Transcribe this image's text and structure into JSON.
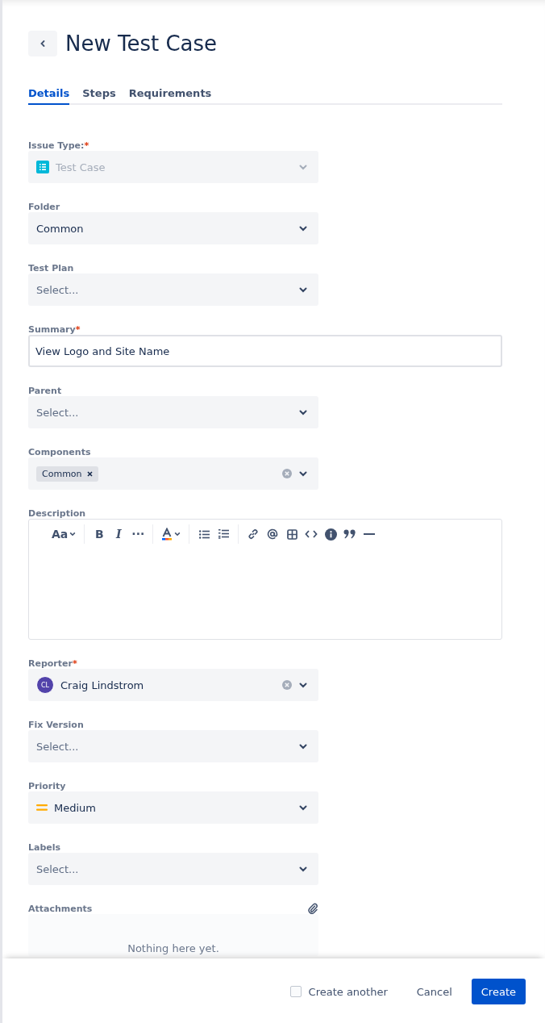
{
  "header": {
    "title": "New Test Case"
  },
  "tabs": [
    {
      "label": "Details",
      "selected": true
    },
    {
      "label": "Steps",
      "selected": false
    },
    {
      "label": "Requirements",
      "selected": false
    }
  ],
  "fields": [
    {
      "kind": "select",
      "label": "Issue Type:",
      "required_mark": "*",
      "disabled": true,
      "lead": {
        "kind": "issue"
      },
      "value": "Test Case"
    },
    {
      "kind": "select",
      "label": "Folder",
      "value": "Common"
    },
    {
      "kind": "select",
      "label": "Test Plan",
      "placeholder": "Select..."
    },
    {
      "kind": "text",
      "label": "Summary",
      "required_mark": "*",
      "value": "View Logo and Site Name"
    },
    {
      "kind": "select",
      "label": "Parent",
      "placeholder": "Select..."
    },
    {
      "kind": "tags",
      "label": "Components",
      "tags": [
        "Common"
      ],
      "clearable": true
    },
    {
      "kind": "editor",
      "label": "Description",
      "toolbar": [
        {
          "kind": "text",
          "label": "Aa",
          "caret": true
        },
        {
          "kind": "separator"
        },
        {
          "kind": "bold",
          "label": "B"
        },
        {
          "kind": "italic",
          "label": "I"
        },
        {
          "kind": "text",
          "label": "···"
        },
        {
          "kind": "separator"
        },
        {
          "kind": "color",
          "caret": true
        },
        {
          "kind": "separator"
        },
        {
          "kind": "bullets"
        },
        {
          "kind": "numbers"
        },
        {
          "kind": "separator"
        },
        {
          "kind": "link"
        },
        {
          "kind": "mention"
        },
        {
          "kind": "table"
        },
        {
          "kind": "code"
        },
        {
          "kind": "info"
        },
        {
          "kind": "quote"
        },
        {
          "kind": "rule"
        }
      ]
    },
    {
      "kind": "select",
      "label": "Reporter",
      "required_mark": "*",
      "lead": {
        "kind": "avatar",
        "initials": "CL"
      },
      "value": "Craig Lindstrom",
      "clearable": true
    },
    {
      "kind": "select",
      "label": "Fix Version",
      "placeholder": "Select..."
    },
    {
      "kind": "select",
      "label": "Priority",
      "lead": {
        "kind": "priority"
      },
      "value": "Medium"
    },
    {
      "kind": "select",
      "label": "Labels",
      "placeholder": "Select..."
    },
    {
      "kind": "attachments",
      "label": "Attachments",
      "empty": "Nothing here yet."
    }
  ],
  "footer": {
    "create_another": {
      "label": "Create another",
      "checked": false
    },
    "cancel": "Cancel",
    "create": "Create"
  }
}
